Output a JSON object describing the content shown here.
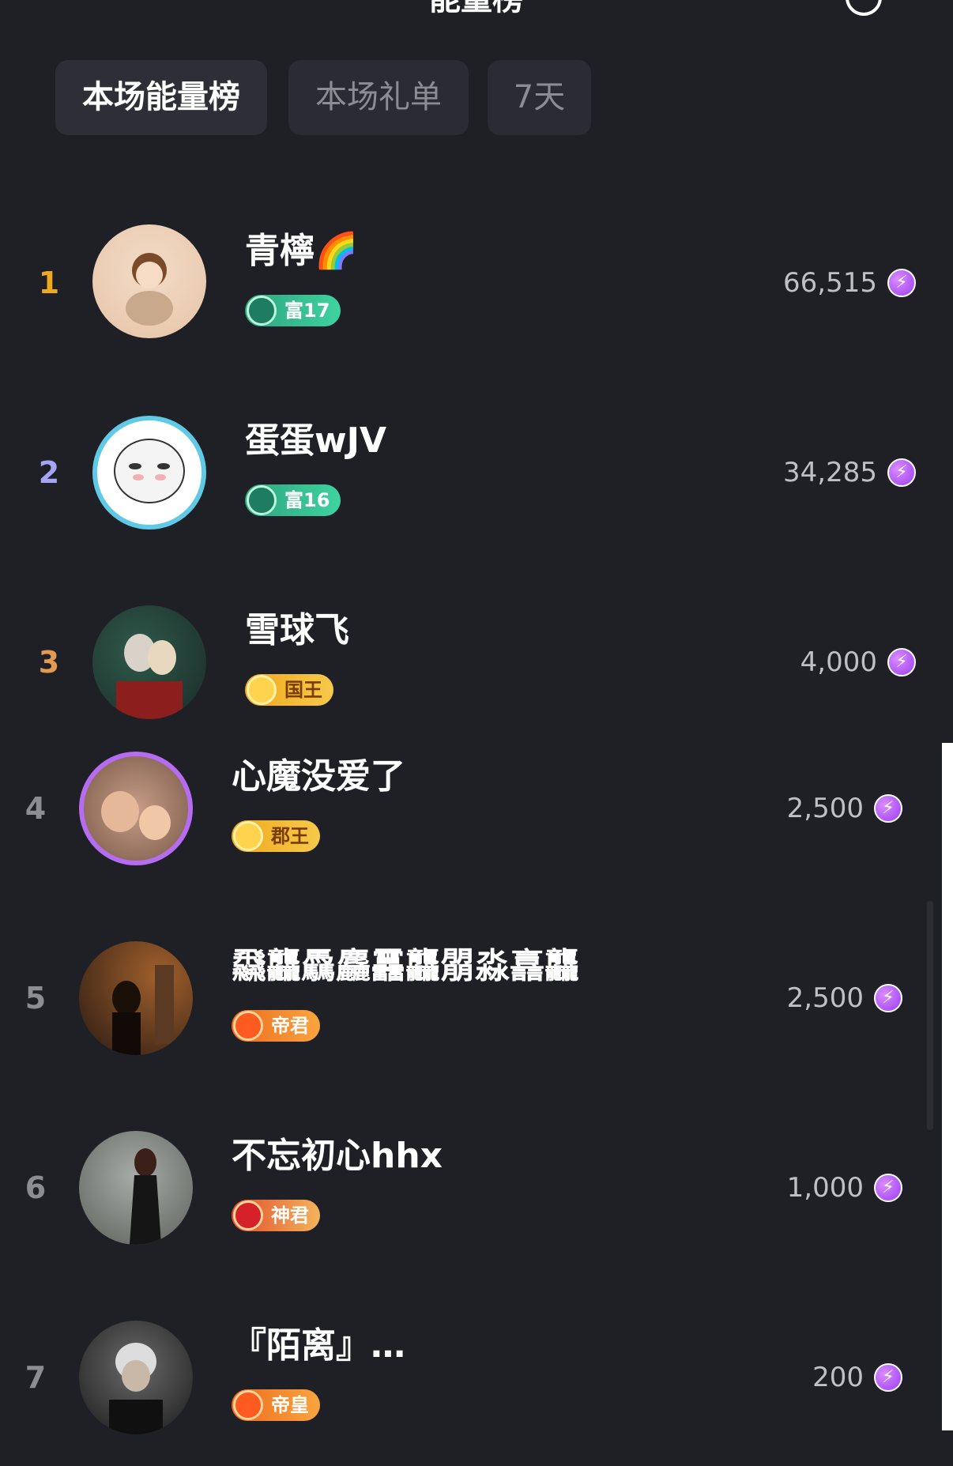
{
  "header": {
    "title": "能量榜"
  },
  "tabs": [
    {
      "label": "本场能量榜",
      "active": true
    },
    {
      "label": "本场礼单",
      "active": false
    },
    {
      "label": "7天",
      "active": false
    }
  ],
  "rows": [
    {
      "rank": "1",
      "name": "青檸🌈",
      "badge": "富17",
      "score": "66,515"
    },
    {
      "rank": "2",
      "name": "蛋蛋wJV",
      "badge": "富16",
      "score": "34,285"
    },
    {
      "rank": "3",
      "name": "雪球飞",
      "badge": "国王",
      "score": "4,000"
    },
    {
      "rank": "4",
      "name": "心魔没爱了",
      "badge": "郡王",
      "score": "2,500"
    },
    {
      "rank": "5",
      "name": "飝龘驫麤靐龘朤淼譶龘",
      "badge": "帝君",
      "score": "2,500"
    },
    {
      "rank": "6",
      "name": "不忘初心hhx",
      "badge": "神君",
      "score": "1,000"
    },
    {
      "rank": "7",
      "name": "『陌离』…",
      "badge": "帝皇",
      "score": "200"
    }
  ],
  "colors": {
    "background": "#1f2026",
    "rank1": "#f0a81e",
    "rank2": "#a7a3f5",
    "rank3": "#e39a52",
    "rank_other": "#8c8d93"
  }
}
